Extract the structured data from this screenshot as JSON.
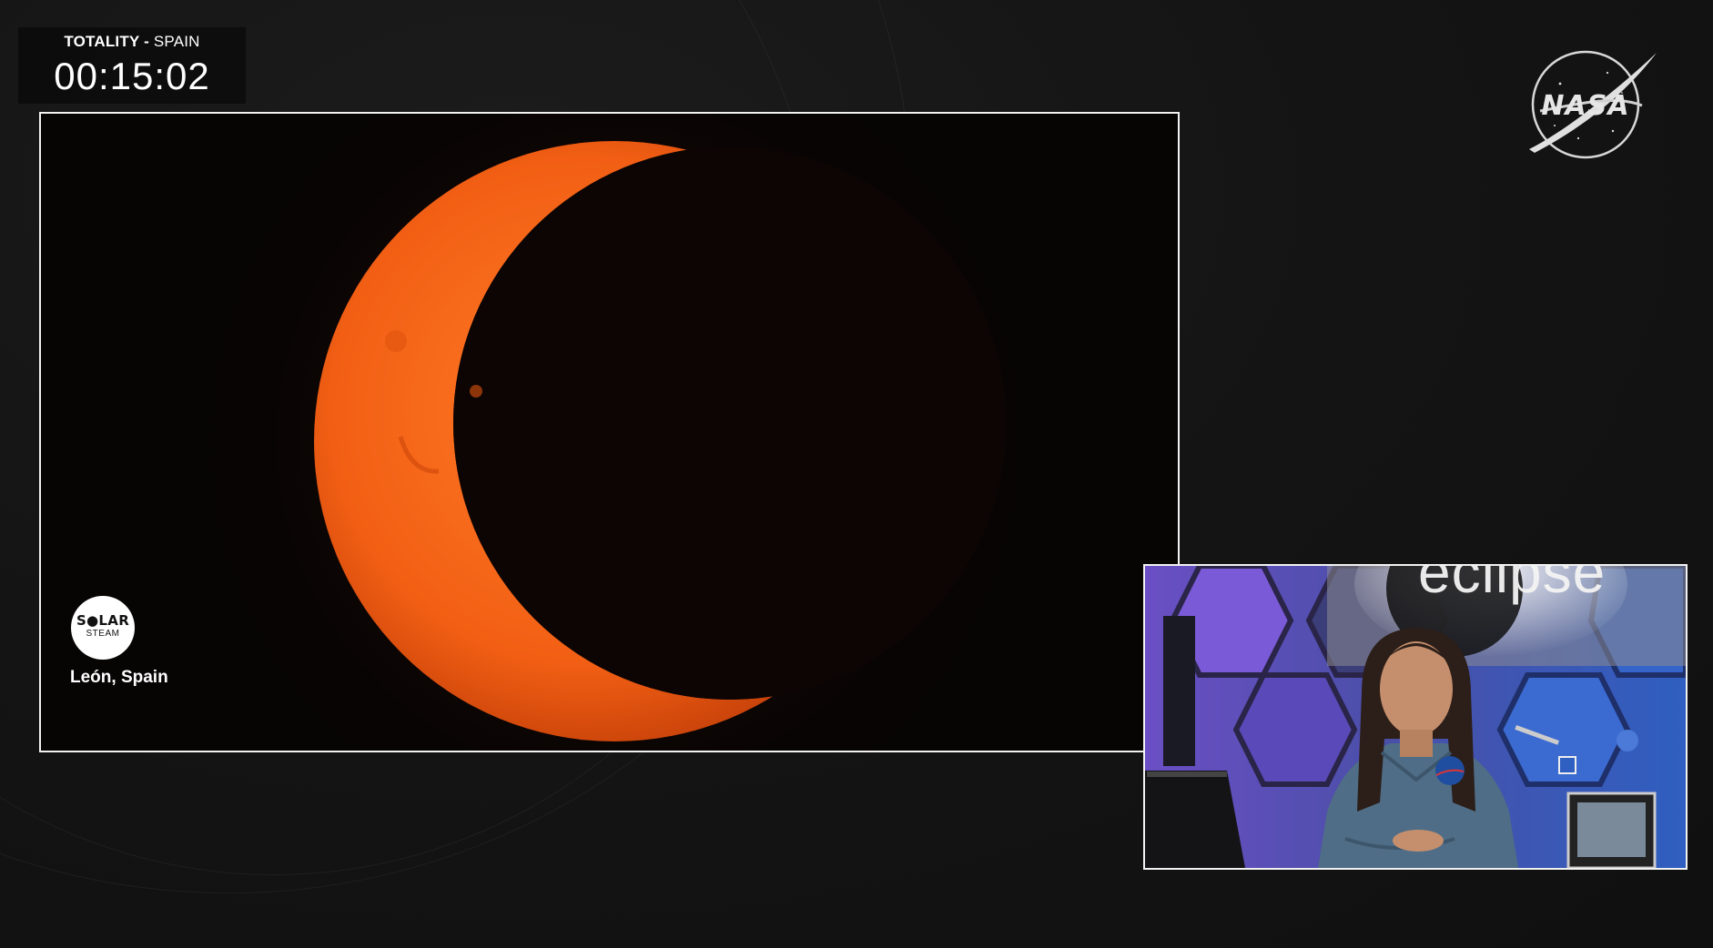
{
  "broadcast": {
    "countdown": {
      "label_prefix": "TOTALITY",
      "label_separator": " - ",
      "label_location": "SPAIN",
      "time": "00:15:02"
    },
    "logo": {
      "text": "NASA",
      "icon": "nasa-meatball-icon"
    }
  },
  "main_feed": {
    "source_badge": {
      "word_top": "S●LAR",
      "word_bottom": "STEAM",
      "icon": "solar-steam-logo-icon"
    },
    "location": "León, Spain"
  },
  "pip_feed": {
    "backdrop_text": "eclipse"
  },
  "colors": {
    "background": "#141414",
    "frame_border": "#f2f2f2",
    "sun_orange": "#ff6a1a",
    "set_purple": "#6a4fc4",
    "set_blue": "#2f5fc0"
  }
}
